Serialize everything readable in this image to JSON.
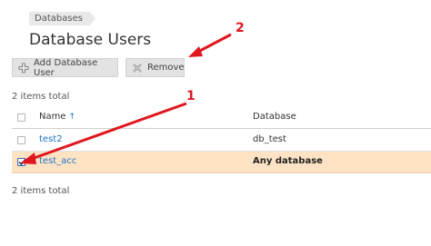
{
  "breadcrumb": {
    "label": "Databases"
  },
  "page": {
    "title": "Database Users"
  },
  "toolbar": {
    "add_label": "Add Database User",
    "remove_label": "Remove",
    "add_icon": "plus-icon",
    "remove_icon": "x-icon"
  },
  "summary": {
    "top": "2 items total",
    "bottom": "2 items total"
  },
  "table": {
    "columns": [
      {
        "label": "Name",
        "sort_indicator": "↑"
      },
      {
        "label": "Database"
      }
    ],
    "rows": [
      {
        "name": "test2",
        "database": "db_test",
        "checked": false
      },
      {
        "name": "test_acc",
        "database": "Any database",
        "checked": true
      }
    ]
  },
  "annotations": {
    "one": "1",
    "two": "2",
    "color": "#e0171f"
  },
  "colors": {
    "selected_row": "#fde3c4",
    "link": "#1a73c8"
  }
}
